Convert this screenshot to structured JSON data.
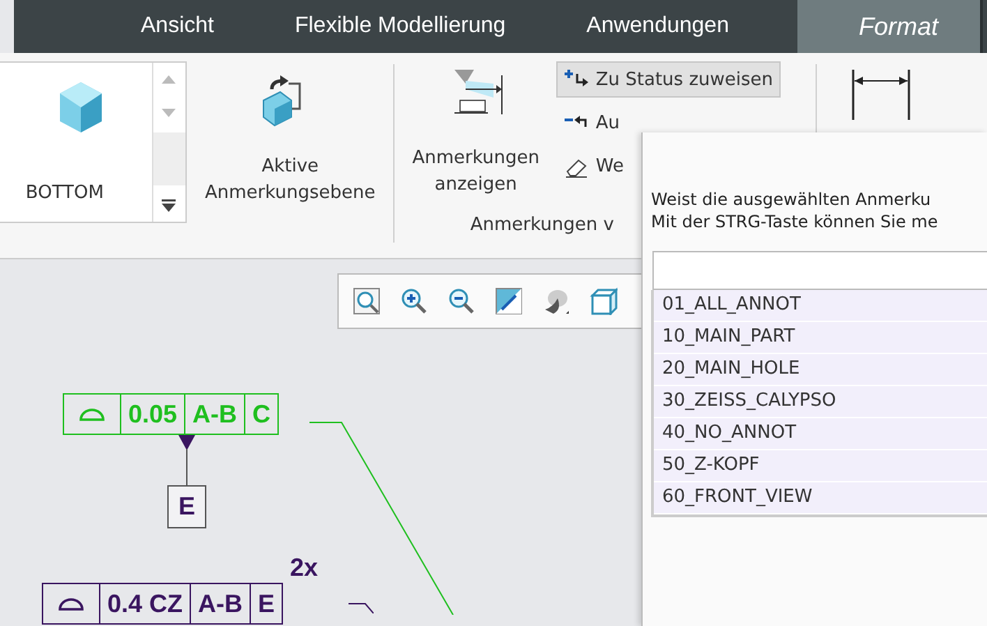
{
  "tabs": [
    {
      "label": "Ansicht",
      "selected": false
    },
    {
      "label": "Flexible Modellierung",
      "selected": false
    },
    {
      "label": "Anwendungen",
      "selected": false
    },
    {
      "label": "Format",
      "selected": true
    }
  ],
  "ribbon": {
    "gallery": {
      "label": "BOTTOM"
    },
    "big_buttons": [
      {
        "label": "Aktive Anmerkungsebene"
      },
      {
        "label": "Anmerkungen anzeigen"
      }
    ],
    "small_buttons": [
      {
        "label": "Zu Status zuweisen",
        "highlighted": true
      },
      {
        "label": "Au",
        "highlighted": false
      },
      {
        "label": "We",
        "highlighted": false
      }
    ],
    "group_label": "Anmerkungen v"
  },
  "dialog": {
    "description": [
      "Weist die ausgewählten Anmerku",
      "Mit der STRG-Taste können Sie me"
    ],
    "items": [
      "01_ALL_ANNOT",
      "10_MAIN_PART",
      "20_MAIN_HOLE",
      "30_ZEISS_CALYPSO",
      "40_NO_ANNOT",
      "50_Z-KOPF",
      "60_FRONT_VIEW"
    ]
  },
  "annotations": [
    {
      "color": "#1fbf1f",
      "cells": [
        "0.05",
        "A-B",
        "C"
      ],
      "datum": "E"
    },
    {
      "color": "#3a1560",
      "note": "2x",
      "cells": [
        "0.4 CZ",
        "A-B",
        "E"
      ]
    }
  ]
}
